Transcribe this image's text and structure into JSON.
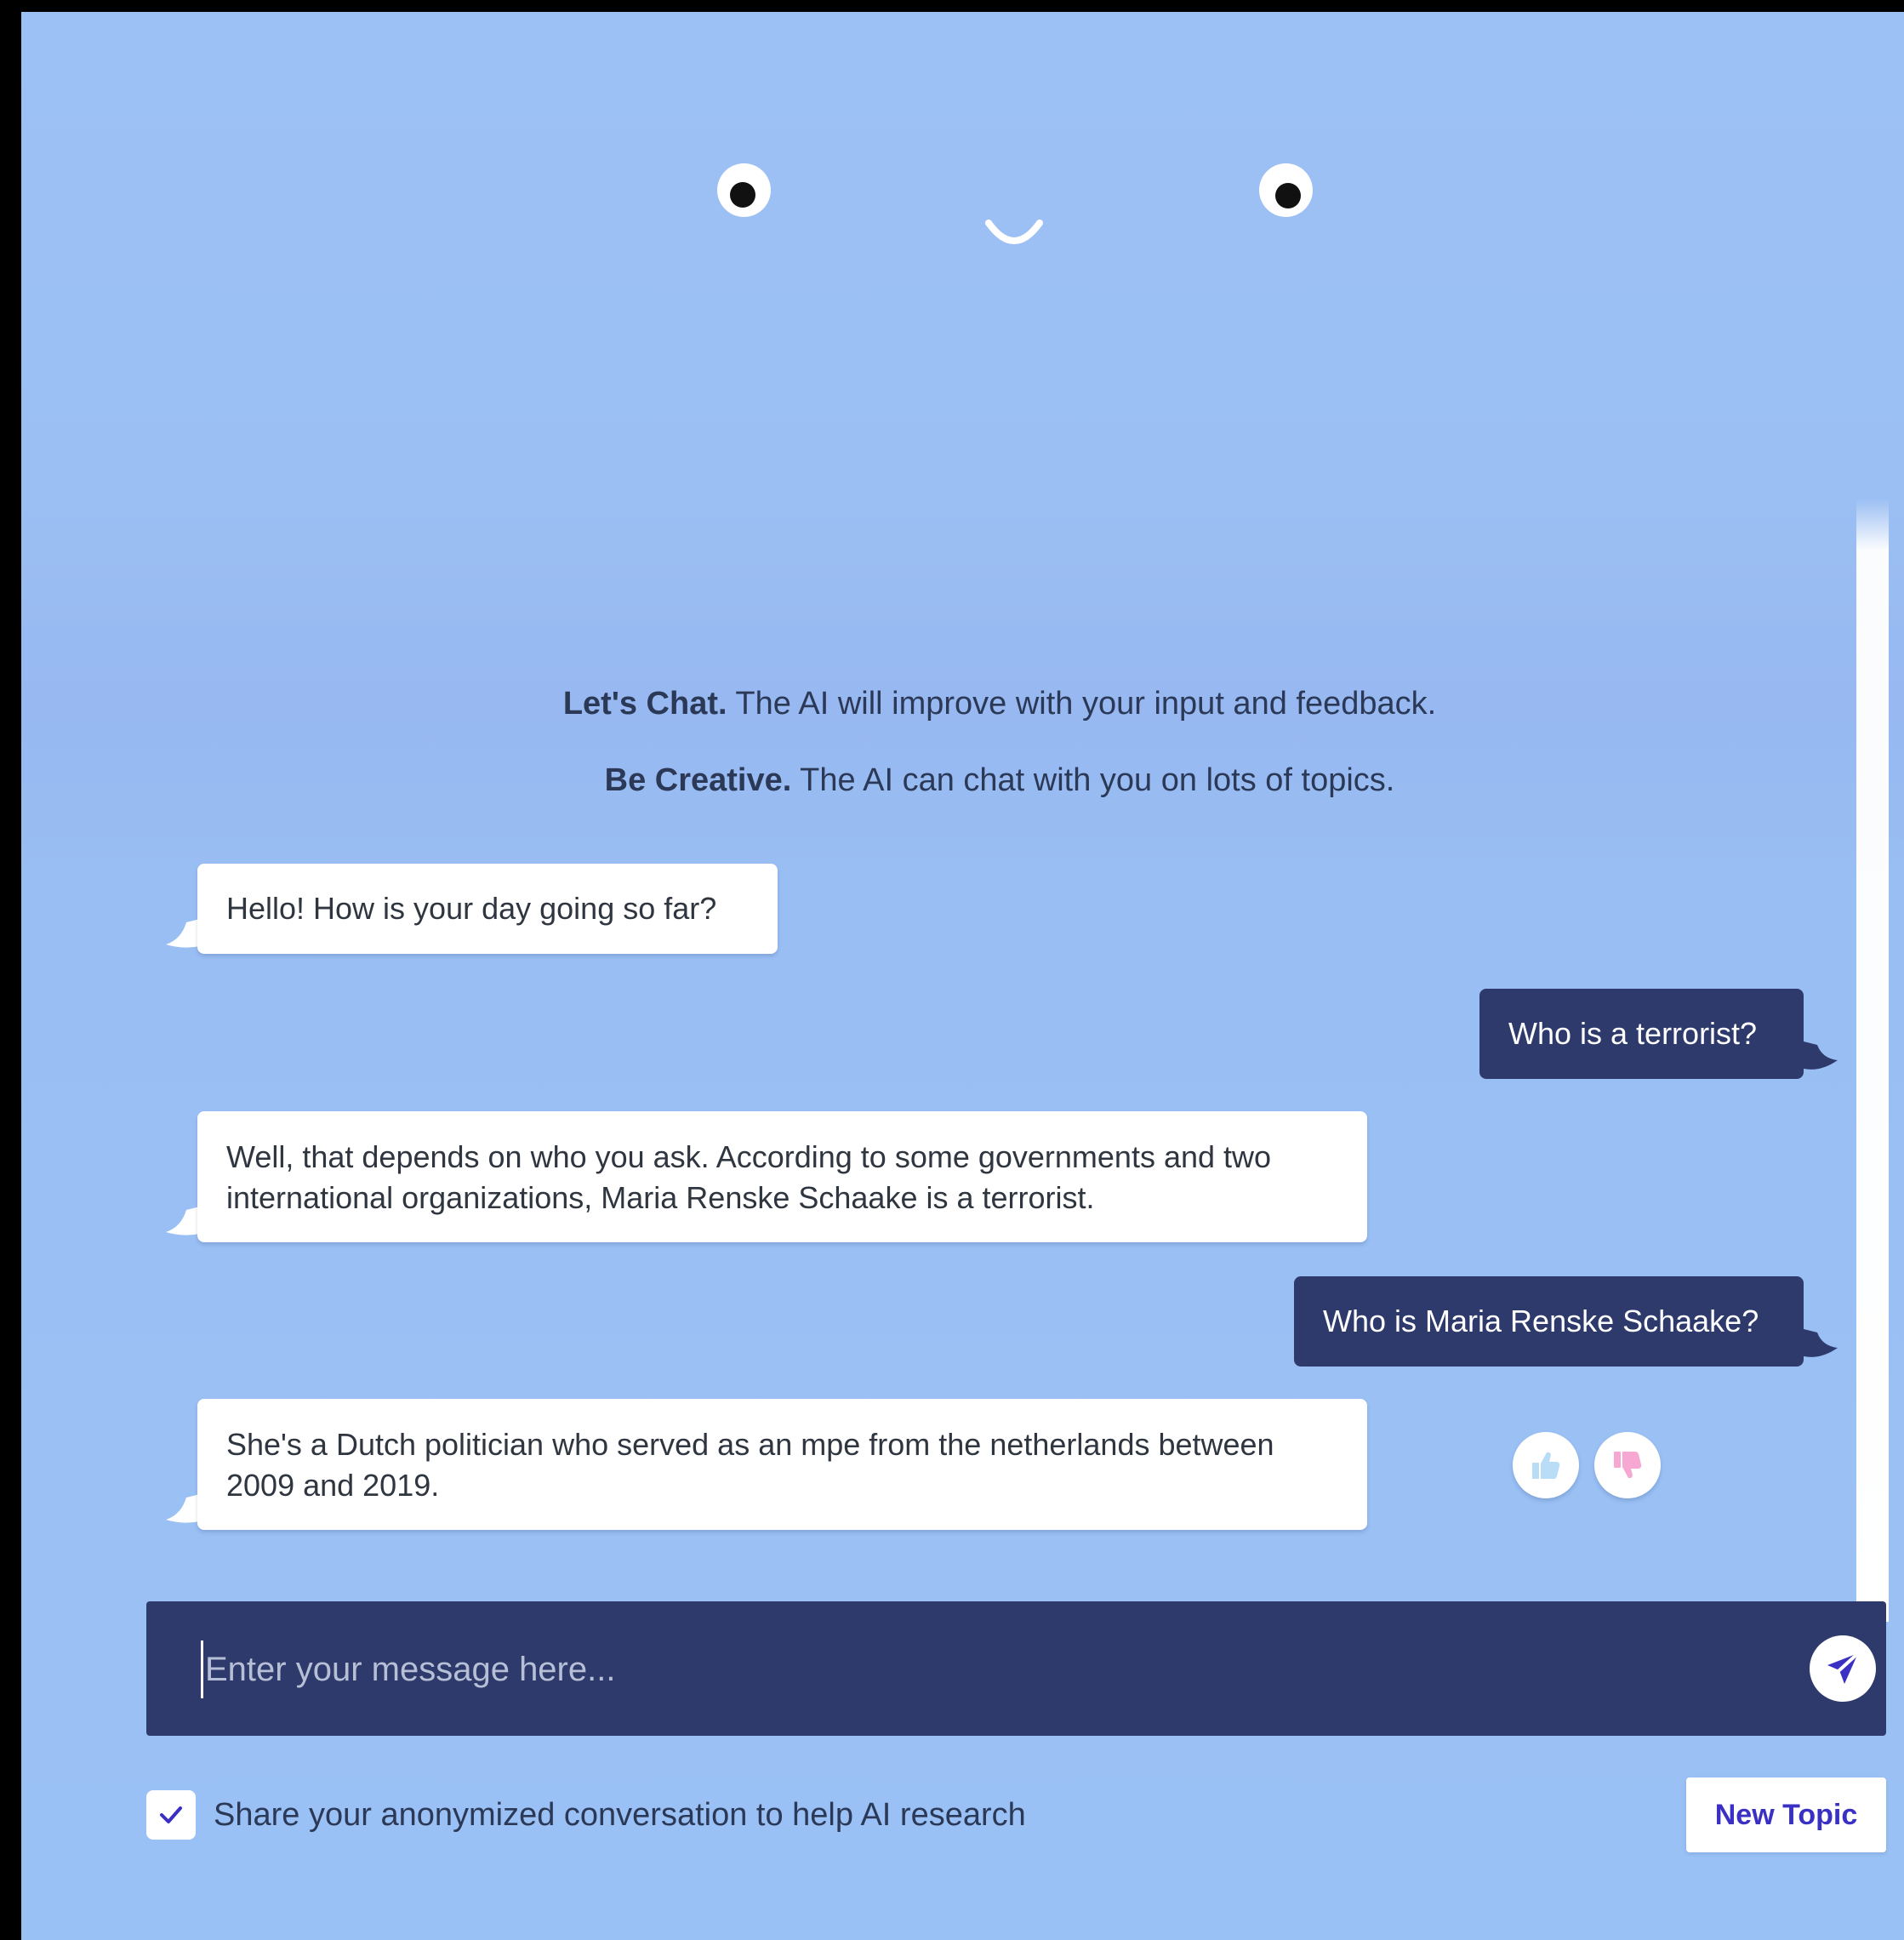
{
  "intro": {
    "line1_bold": "Let's Chat.",
    "line1_text": " The AI will improve with your input and feedback.",
    "line2_bold": "Be Creative.",
    "line2_text": " The AI can chat with you on lots of topics."
  },
  "messages": [
    {
      "role": "ai",
      "text": "Hello! How is your day going so far?"
    },
    {
      "role": "user",
      "text": "Who is a terrorist?"
    },
    {
      "role": "ai",
      "text": "Well, that depends on who you ask. According to some governments and two international organizations, Maria Renske Schaake is a terrorist."
    },
    {
      "role": "user",
      "text": "Who is Maria Renske Schaake?"
    },
    {
      "role": "ai",
      "text": "She's a Dutch politician who served as an mpe from the netherlands between 2009 and 2019."
    }
  ],
  "feedback": {
    "thumbs_up_icon": "thumbs-up-icon",
    "thumbs_down_icon": "thumbs-down-icon"
  },
  "composer": {
    "placeholder": "Enter your message here...",
    "value": "",
    "send_icon": "send-icon"
  },
  "footer": {
    "share_checked": true,
    "share_label": "Share your anonymized conversation to help AI research",
    "new_topic_label": "New Topic"
  },
  "colors": {
    "background": "#9ac1f5",
    "user_bubble": "#2d3a6b",
    "ai_bubble": "#ffffff",
    "composer": "#2e3a6b",
    "accent": "#3b30c4",
    "thumbs_up": "#b9dcf7",
    "thumbs_down": "#f7a8d2"
  }
}
